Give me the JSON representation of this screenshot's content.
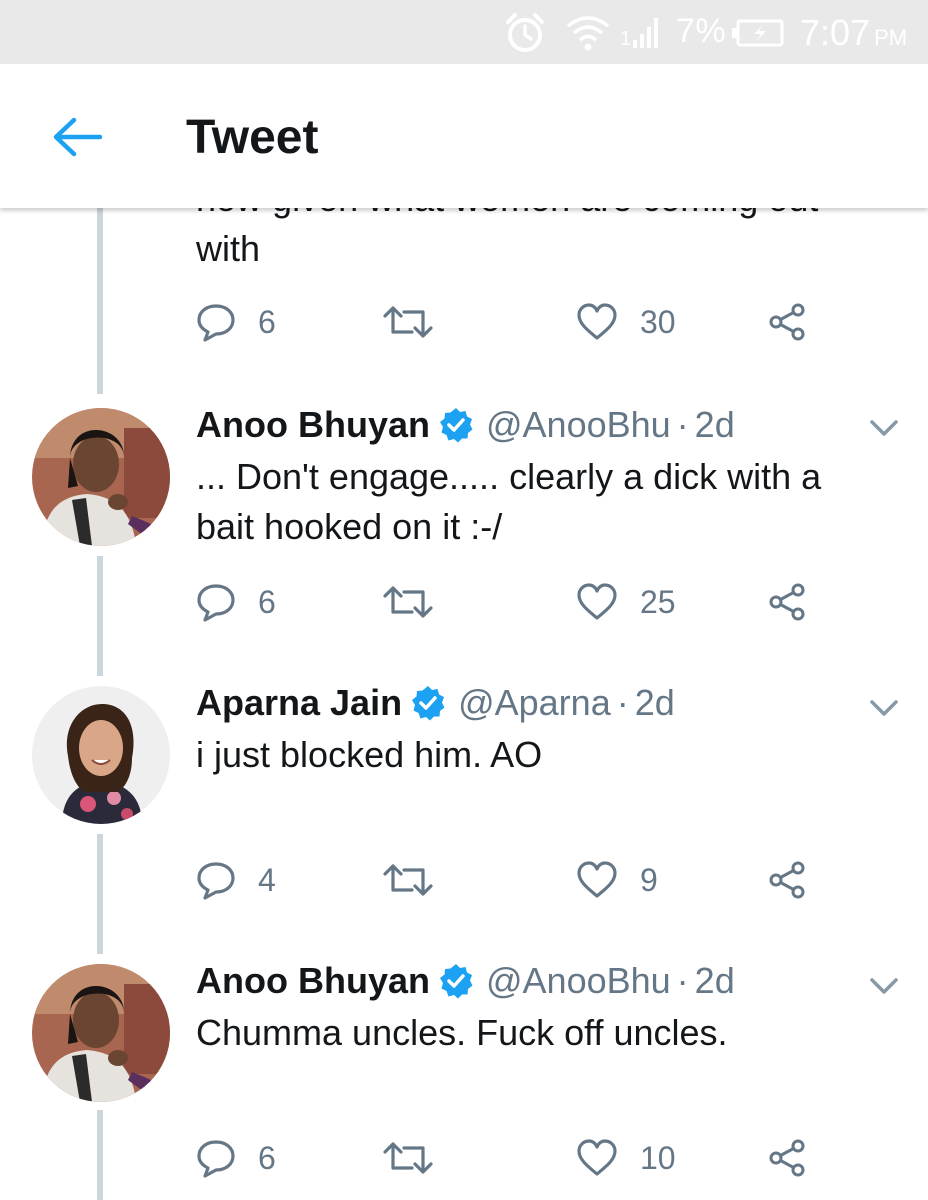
{
  "status_bar": {
    "signal_label": "1",
    "battery": "7%",
    "time": "7:07",
    "ampm": "PM",
    "icons": [
      "alarm-icon",
      "wifi-icon",
      "cell-signal-icon",
      "battery-charging-icon"
    ]
  },
  "app_bar": {
    "title": "Tweet",
    "back_icon": "arrow-left-icon"
  },
  "colors": {
    "accent": "#1da1f2",
    "text": "#14171a",
    "secondary": "#657786",
    "icon": "#657786",
    "thread_line": "#ccd6dd"
  },
  "partial_tweet": {
    "text_tail": "with",
    "cut_text": "now given what women are coming out",
    "replies": "6",
    "likes": "30"
  },
  "tweets": [
    {
      "name": "Anoo Bhuyan",
      "verified": true,
      "handle": "@AnooBhu",
      "time": "2d",
      "text": "... Don't engage..... clearly a dick with a bait hooked on it :-/",
      "replies": "6",
      "likes": "25"
    },
    {
      "name": "Aparna Jain",
      "verified": true,
      "handle": "@Aparna",
      "time": "2d",
      "text": "i just blocked him. AO",
      "replies": "4",
      "likes": "9"
    },
    {
      "name": "Anoo Bhuyan",
      "verified": true,
      "handle": "@AnooBhu",
      "time": "2d",
      "text": "Chumma uncles. Fuck off uncles.",
      "replies": "6",
      "likes": "10"
    }
  ],
  "separator": "·"
}
